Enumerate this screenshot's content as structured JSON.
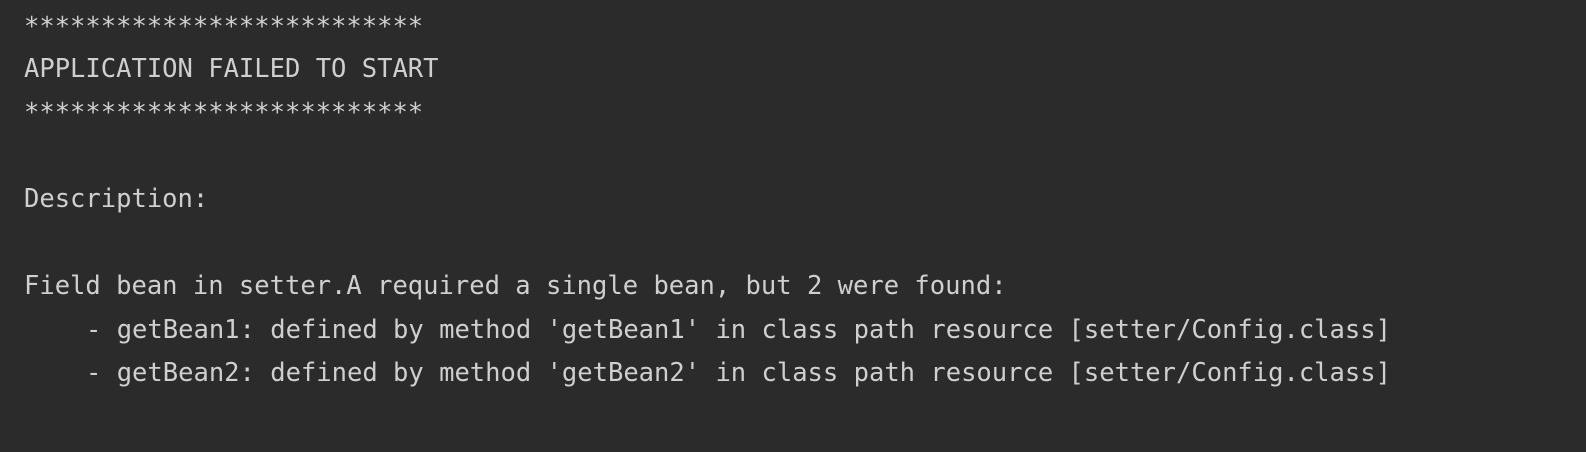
{
  "console": {
    "lines": {
      "stars_top": "**************************",
      "title": "APPLICATION FAILED TO START",
      "stars_bottom": "**************************",
      "description_label": "Description:",
      "field_message": "Field bean in setter.A required a single bean, but 2 were found:",
      "bean1": "- getBean1: defined by method 'getBean1' in class path resource [setter/Config.class]",
      "bean2": "- getBean2: defined by method 'getBean2' in class path resource [setter/Config.class]"
    }
  }
}
